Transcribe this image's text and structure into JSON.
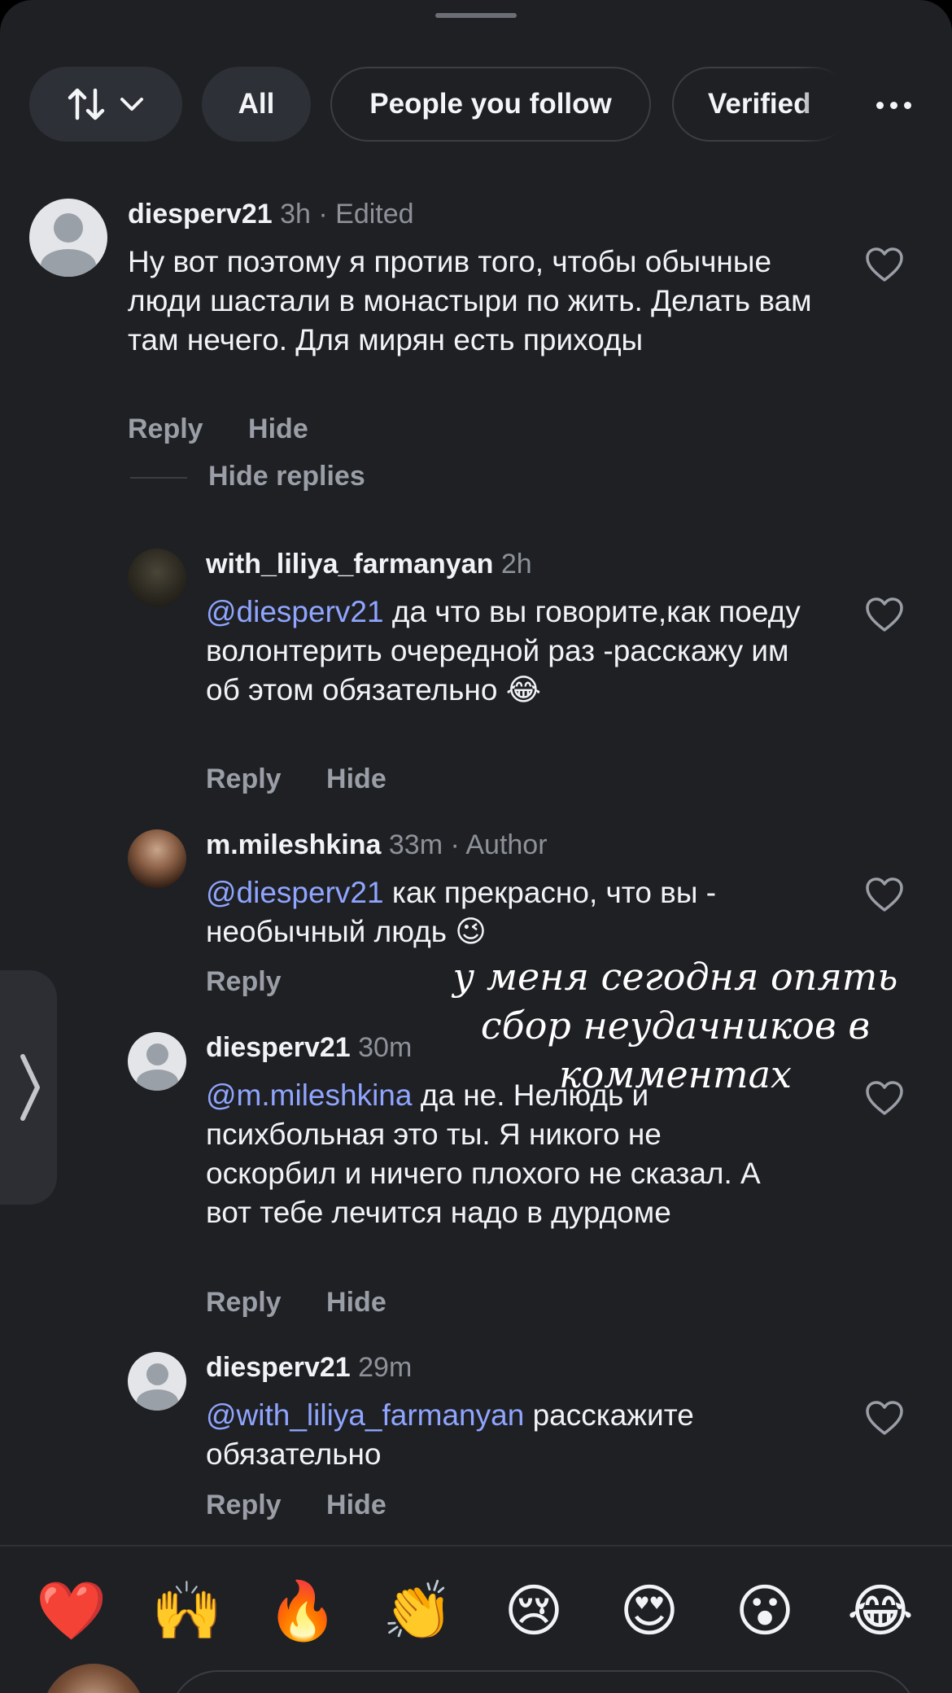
{
  "filters": {
    "sort_icon": "sort-arrows-icon",
    "chevron_icon": "chevron-down-icon",
    "all": "All",
    "people_you_follow": "People you follow",
    "verified": "Verified",
    "more_icon": "more-horizontal-icon"
  },
  "comments": [
    {
      "username": "diesperv21",
      "meta": "3h · Edited",
      "mention": "",
      "text": "Ну вот поэтому я против того, чтобы обычные люди шастали в монастыри по жить. Делать вам там нечего. Для мирян есть приходы",
      "reply": "Reply",
      "hide": "Hide"
    },
    {
      "username": "with_liliya_farmanyan",
      "meta": "2h",
      "mention": "@diesperv21",
      "text": " да что вы говорите,как поеду волонтерить очередной раз -расскажу им об этом обязательно 😂",
      "reply": "Reply",
      "hide": "Hide"
    },
    {
      "username": "m.mileshkina",
      "meta": "33m · Author",
      "mention": "@diesperv21",
      "text": " как прекрасно, что вы - необычный людь 😉",
      "reply": "Reply",
      "hide": ""
    },
    {
      "username": "diesperv21",
      "meta": "30m",
      "mention": "@m.mileshkina",
      "text": " да не. Нелюдь и психбольная это ты. Я никого не оскорбил и ничего плохого не сказал. А вот тебе лечится надо в дурдоме",
      "reply": "Reply",
      "hide": "Hide"
    },
    {
      "username": "diesperv21",
      "meta": "29m",
      "mention": "@with_liliya_farmanyan",
      "text": " расскажите обязательно",
      "reply": "Reply",
      "hide": "Hide"
    }
  ],
  "hide_replies": "Hide replies",
  "overlay_note": "у меня сегодня опять сбор неудачников в комментах",
  "emoji_bar": [
    "❤️",
    "🙌",
    "🔥",
    "👏",
    "😢",
    "😍",
    "😮",
    "😂"
  ],
  "colors": {
    "background": "#1f2024",
    "mention": "#8fa5ff",
    "secondary_text": "#9a9ea6"
  }
}
